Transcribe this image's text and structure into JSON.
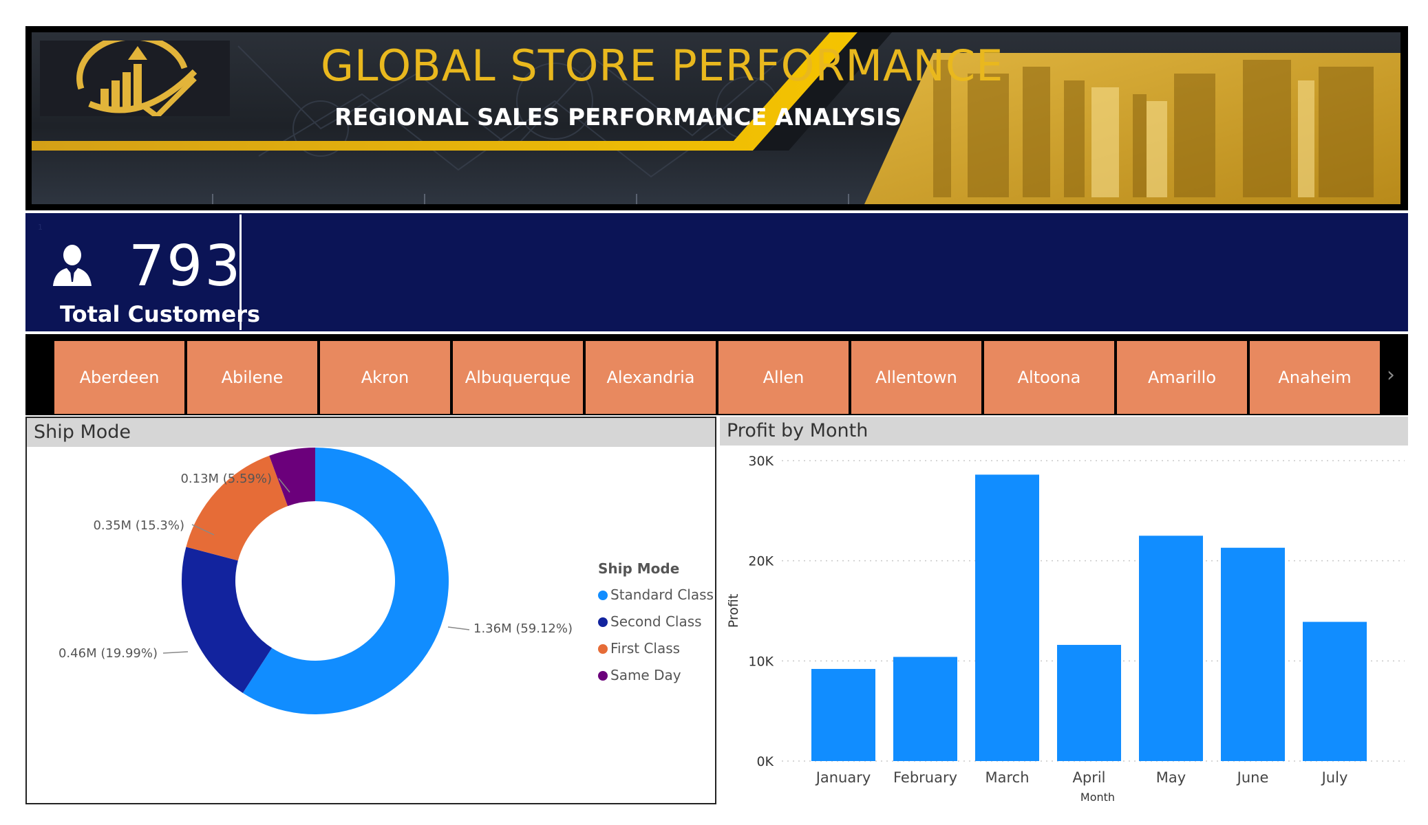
{
  "banner": {
    "title": "GLOBAL STORE PERFORMANCE",
    "subtitle": "REGIONAL SALES PERFORMANCE ANALYSIS"
  },
  "kpi": {
    "value": "793",
    "label": "Total Customers",
    "corner_mark": "1"
  },
  "cities": [
    "Aberdeen",
    "Abilene",
    "Akron",
    "Albuquerque",
    "Alexandria",
    "Allen",
    "Allentown",
    "Altoona",
    "Amarillo",
    "Anaheim"
  ],
  "ship_panel": {
    "title": "Ship Mode"
  },
  "profit_panel": {
    "title": "Profit by Month"
  },
  "colors": {
    "standard": "#118dff",
    "second": "#12239e",
    "first": "#e66c37",
    "sameday": "#6b007b",
    "bar": "#118dff",
    "navy": "#0b1456",
    "slicer_tile": "#e8895f",
    "gold": "#e9b81e"
  },
  "chart_data": [
    {
      "type": "pie",
      "donut": true,
      "legend_title": "Ship Mode",
      "legend_position": "right",
      "slices": [
        {
          "label": "Standard Class",
          "value": 1.36,
          "percent": 59.12,
          "data_label": "1.36M (59.12%)"
        },
        {
          "label": "Second Class",
          "value": 0.46,
          "percent": 19.99,
          "data_label": "0.46M (19.99%)"
        },
        {
          "label": "First Class",
          "value": 0.35,
          "percent": 15.3,
          "data_label": "0.35M (15.3%)"
        },
        {
          "label": "Same Day",
          "value": 0.13,
          "percent": 5.59,
          "data_label": "0.13M (5.59%)"
        }
      ]
    },
    {
      "type": "bar",
      "categories": [
        "January",
        "February",
        "March",
        "April",
        "May",
        "June",
        "July"
      ],
      "values": [
        9200,
        10400,
        28600,
        11600,
        22500,
        21300,
        13900
      ],
      "xlabel": "Month",
      "ylabel": "Profit",
      "ylim": [
        0,
        30000
      ],
      "yticks": [
        0,
        10000,
        20000,
        30000
      ],
      "ytick_labels": [
        "0K",
        "10K",
        "20K",
        "30K"
      ],
      "grid": true
    }
  ]
}
